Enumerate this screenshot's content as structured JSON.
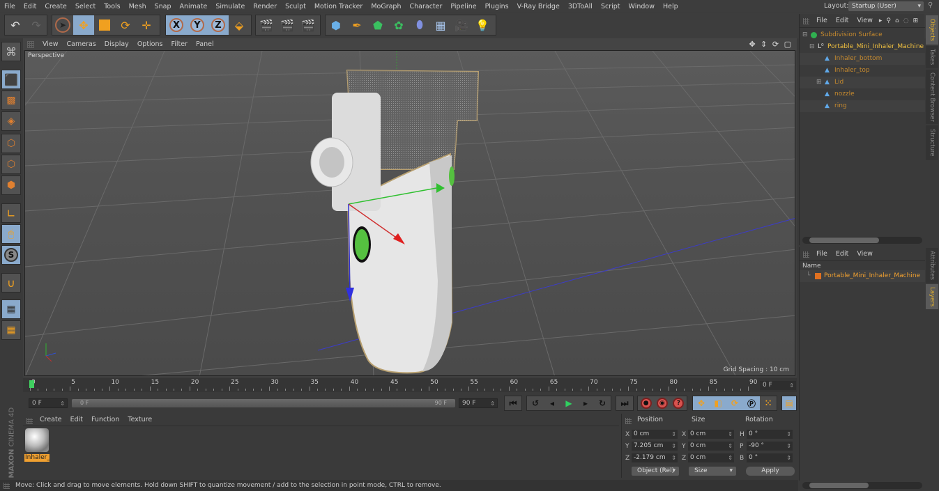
{
  "menubar": {
    "items": [
      "File",
      "Edit",
      "Create",
      "Select",
      "Tools",
      "Mesh",
      "Snap",
      "Animate",
      "Simulate",
      "Render",
      "Sculpt",
      "Motion Tracker",
      "MoGraph",
      "Character",
      "Pipeline",
      "Plugins",
      "V-Ray Bridge",
      "3DToAll",
      "Script",
      "Window",
      "Help"
    ],
    "layout_label": "Layout:",
    "layout_value": "Startup (User)"
  },
  "toolbar": {
    "undo": "undo-icon",
    "redo": "redo-icon",
    "axis_labels": [
      "X",
      "Y",
      "Z"
    ]
  },
  "viewport": {
    "menu": [
      "View",
      "Cameras",
      "Display",
      "Options",
      "Filter",
      "Panel"
    ],
    "camera_label": "Perspective",
    "grid_spacing": "Grid Spacing : 10 cm",
    "nav_icons": "✥ ⇕ ⟳ ▢"
  },
  "timeline": {
    "ticks": [
      "0",
      "5",
      "10",
      "15",
      "20",
      "25",
      "30",
      "35",
      "40",
      "45",
      "50",
      "55",
      "60",
      "65",
      "70",
      "75",
      "80",
      "85",
      "90"
    ],
    "current_frame_field": "0 F",
    "start_field": "0 F",
    "range_start": "0 F",
    "range_end": "90 F",
    "end_field": "90 F",
    "current_frame_fraction": 0
  },
  "materials": {
    "menu": [
      "Create",
      "Edit",
      "Function",
      "Texture"
    ],
    "items": [
      {
        "name": "Inhaler_"
      }
    ]
  },
  "branding": {
    "maxon": "MAXON",
    "product": "CINEMA 4D"
  },
  "coordinates": {
    "headers": {
      "position": "Position",
      "size": "Size",
      "rotation": "Rotation"
    },
    "position": {
      "x": "0 cm",
      "y": "7.205 cm",
      "z": "-2.179 cm"
    },
    "size": {
      "x": "0 cm",
      "y": "0 cm",
      "z": "0 cm"
    },
    "rotation": {
      "h": "0 °",
      "p": "-90 °",
      "b": "0 °"
    },
    "axis_letters": {
      "x": "X",
      "y": "Y",
      "z": "Z",
      "h": "H",
      "p": "P",
      "b": "B"
    },
    "mode_dropdown": "Object (Rel)",
    "size_dropdown": "Size",
    "apply_label": "Apply"
  },
  "status": {
    "text": "Move: Click and drag to move elements. Hold down SHIFT to quantize movement / add to the selection in point mode, CTRL to remove."
  },
  "objects_panel": {
    "menu": [
      "File",
      "Edit",
      "View"
    ],
    "tree": [
      {
        "label": "Subdivision Surface",
        "level": 0
      },
      {
        "label": "Portable_Mini_Inhaler_Machine",
        "level": 1
      },
      {
        "label": "Inhaler_bottom",
        "level": 2
      },
      {
        "label": "Inhaler_top",
        "level": 2
      },
      {
        "label": "Lid",
        "level": 2
      },
      {
        "label": "nozzle",
        "level": 2
      },
      {
        "label": "ring",
        "level": 2
      }
    ]
  },
  "right_tabs": {
    "top": [
      "Objects",
      "Takes",
      "Content Browser",
      "Structure"
    ],
    "bottom": [
      "Attributes",
      "Layers"
    ]
  },
  "layers_panel": {
    "menu": [
      "File",
      "Edit",
      "View"
    ],
    "column_name": "Name",
    "items": [
      {
        "label": "Portable_Mini_Inhaler_Machine",
        "color": "#e07020"
      }
    ]
  },
  "colors": {
    "accent_orange": "#e0a030",
    "active_blue": "#8aaacc",
    "record_red": "#d9534f"
  }
}
